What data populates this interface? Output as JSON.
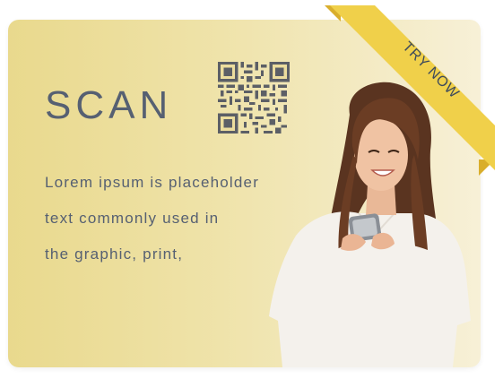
{
  "card": {
    "title": "SCAN",
    "description_lines": [
      "Lorem ipsum is placeholder",
      "text commonly  used in",
      "the graphic, print,"
    ]
  },
  "ribbon": {
    "label": "TRY NOW"
  },
  "colors": {
    "text": "#566072",
    "ribbon": "#f0d04a",
    "ribbon_fold": "#d9ae2c",
    "card_gradient_start": "#e9d98d",
    "card_gradient_end": "#f7f0d7"
  },
  "icons": {
    "qr": "qr-code-icon"
  }
}
